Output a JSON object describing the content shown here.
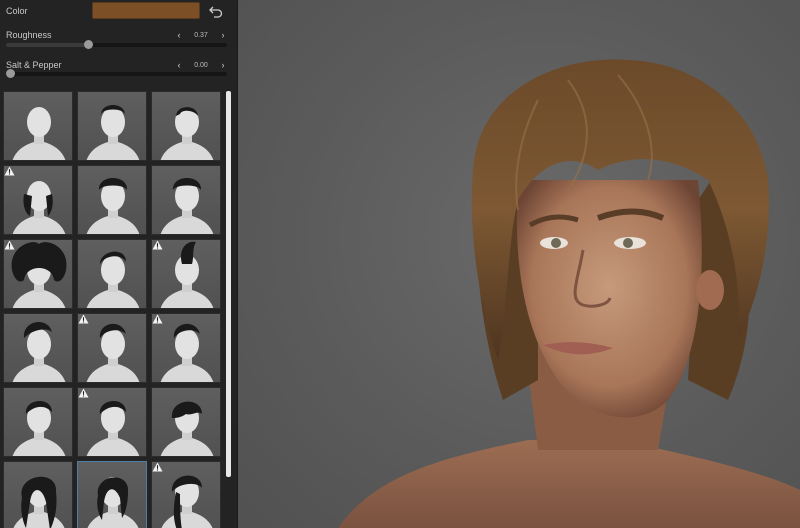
{
  "color": {
    "label": "Color",
    "swatch_color": "#7d4f26"
  },
  "roughness": {
    "label": "Roughness",
    "value": "0.37",
    "fraction": 0.37
  },
  "salt_pepper": {
    "label": "Salt & Pepper",
    "value": "0.00",
    "fraction": 0.0
  },
  "grid": {
    "tiles": [
      {
        "hair": "bald",
        "warning": false,
        "selected": false
      },
      {
        "hair": "short",
        "warning": false,
        "selected": false
      },
      {
        "hair": "receding",
        "warning": false,
        "selected": false
      },
      {
        "hair": "balding-sides",
        "warning": true,
        "selected": false
      },
      {
        "hair": "curly-short",
        "warning": false,
        "selected": false
      },
      {
        "hair": "curly-short",
        "warning": false,
        "selected": false
      },
      {
        "hair": "afro",
        "warning": true,
        "selected": false
      },
      {
        "hair": "undercut",
        "warning": false,
        "selected": false
      },
      {
        "hair": "mohawk",
        "warning": true,
        "selected": false
      },
      {
        "hair": "pompadour",
        "warning": false,
        "selected": false
      },
      {
        "hair": "quiff",
        "warning": true,
        "selected": false
      },
      {
        "hair": "quiff",
        "warning": true,
        "selected": false
      },
      {
        "hair": "side-part",
        "warning": false,
        "selected": false
      },
      {
        "hair": "side-part",
        "warning": true,
        "selected": false
      },
      {
        "hair": "fringe",
        "warning": false,
        "selected": false
      },
      {
        "hair": "long",
        "warning": false,
        "selected": false
      },
      {
        "hair": "medium",
        "warning": false,
        "selected": true
      },
      {
        "hair": "ponytail",
        "warning": true,
        "selected": false
      }
    ]
  },
  "icons": {
    "undo": "undo-icon",
    "warning": "warning-icon",
    "prev": "chevron-left-icon",
    "next": "chevron-right-icon"
  },
  "arrows": {
    "prev": "‹",
    "next": "›"
  }
}
